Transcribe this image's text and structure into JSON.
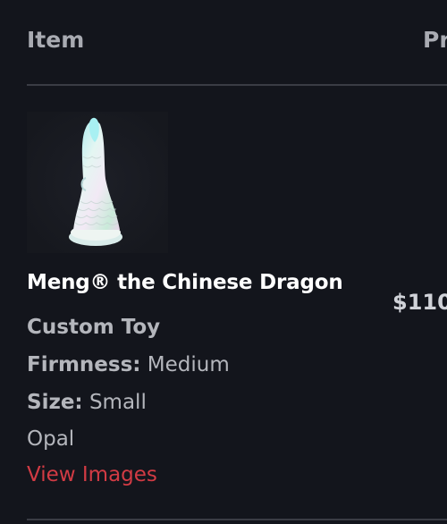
{
  "table": {
    "col_item": "Item",
    "col_price": "Pr"
  },
  "product": {
    "image_icon": "dragon-product-image",
    "name": "Meng® the Chinese Dragon",
    "price": "$110",
    "type": "Custom Toy",
    "firmness_label": "Firmness:",
    "firmness_value": "Medium",
    "size_label": "Size:",
    "size_value": "Small",
    "color": "Opal",
    "view_images_link": "View Images"
  },
  "colors": {
    "background": "#13151c",
    "link": "#d23b44",
    "heading": "#a9abb2",
    "divider": "#3a3c44"
  }
}
